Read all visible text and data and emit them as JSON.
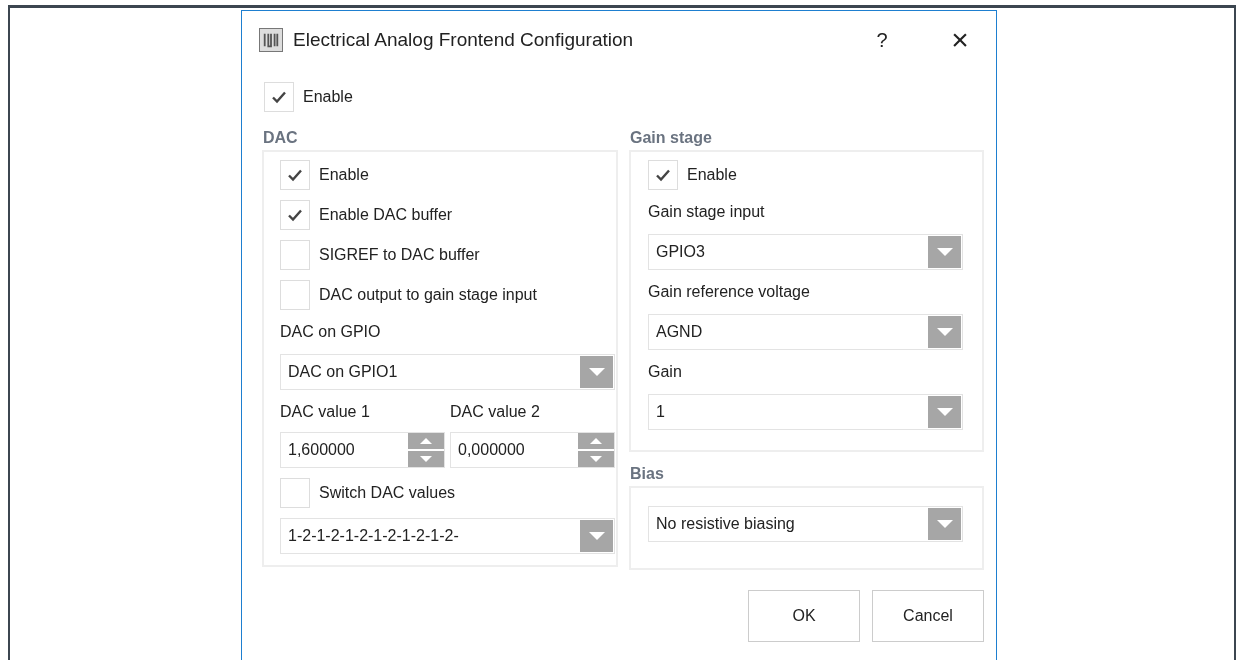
{
  "window": {
    "title": "Electrical Analog Frontend Configuration",
    "help": "?",
    "close": "×"
  },
  "enable": {
    "label": "Enable",
    "checked": true
  },
  "dac": {
    "title": "DAC",
    "controls": [
      {
        "kind": "checkbox",
        "label": "Enable",
        "checked": true
      },
      {
        "kind": "checkbox",
        "label": "Enable DAC buffer",
        "checked": true
      },
      {
        "kind": "checkbox",
        "label": "SIGREF to DAC buffer",
        "checked": false
      },
      {
        "kind": "checkbox",
        "label": "DAC output to gain stage input",
        "checked": false
      },
      {
        "kind": "label",
        "text": "DAC on GPIO"
      },
      {
        "kind": "combo",
        "value": "DAC on GPIO1"
      },
      {
        "kind": "spin_pair",
        "fields": [
          {
            "label": "DAC value 1",
            "value": "1,600000"
          },
          {
            "label": "DAC value 2",
            "value": "0,000000"
          }
        ]
      },
      {
        "kind": "checkbox",
        "label": "Switch DAC values",
        "checked": false
      },
      {
        "kind": "combo",
        "value": "1-2-1-2-1-2-1-2-1-2-1-2-"
      }
    ]
  },
  "gain_stage": {
    "title": "Gain stage",
    "controls": [
      {
        "kind": "checkbox",
        "label": "Enable",
        "checked": true
      },
      {
        "kind": "label",
        "text": "Gain stage input"
      },
      {
        "kind": "combo",
        "value": "GPIO3"
      },
      {
        "kind": "label",
        "text": "Gain reference voltage"
      },
      {
        "kind": "combo",
        "value": "AGND"
      },
      {
        "kind": "label",
        "text": "Gain"
      },
      {
        "kind": "combo",
        "value": "1"
      }
    ]
  },
  "bias": {
    "title": "Bias",
    "controls": [
      {
        "kind": "combo",
        "value": "No resistive biasing"
      }
    ]
  },
  "buttons": [
    "OK",
    "Cancel"
  ]
}
